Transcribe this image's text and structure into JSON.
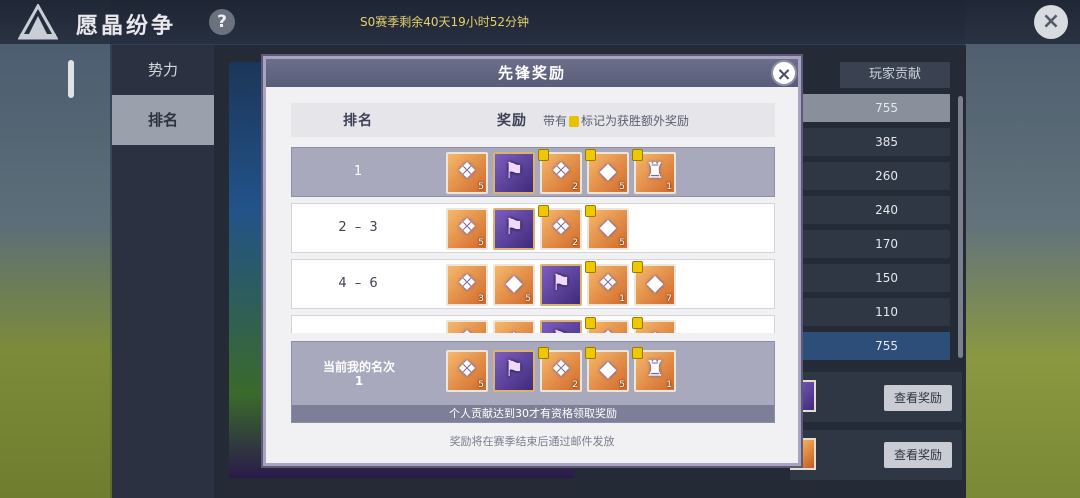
{
  "topbar": {
    "title": "愿晶纷争",
    "help_label": "?",
    "season_timer": "S0赛季剩余40天19小时52分钟",
    "close_label": "×"
  },
  "sidebar": {
    "tabs": [
      {
        "label": "势力",
        "active": false
      },
      {
        "label": "排名",
        "active": true
      }
    ]
  },
  "background": {
    "contrib_header": "玩家贡献",
    "contrib_values": [
      "755",
      "385",
      "260",
      "240",
      "170",
      "150",
      "110",
      "755"
    ],
    "view_reward_label": "查看奖励"
  },
  "modal": {
    "title": "先锋奖励",
    "close_label": "×",
    "col_rank": "排名",
    "col_reward": "奖励",
    "note_prefix": "带有",
    "note_suffix": "标记为获胜额外奖励",
    "rows": [
      {
        "rank": "1",
        "items": [
          {
            "icon": "crystal-drops",
            "qty": "5",
            "extra": false,
            "style": "orange"
          },
          {
            "icon": "purple-banner",
            "qty": "",
            "extra": false,
            "style": "purple"
          },
          {
            "icon": "crystal-drops",
            "qty": "2",
            "extra": true,
            "style": "orange"
          },
          {
            "icon": "crystal-drop",
            "qty": "5",
            "extra": true,
            "style": "orange"
          },
          {
            "icon": "trophy-chest",
            "qty": "1",
            "extra": true,
            "style": "orange"
          }
        ]
      },
      {
        "rank": "2 – 3",
        "items": [
          {
            "icon": "crystal-drops",
            "qty": "5",
            "extra": false,
            "style": "orange"
          },
          {
            "icon": "purple-banner",
            "qty": "",
            "extra": false,
            "style": "purple"
          },
          {
            "icon": "crystal-drops",
            "qty": "2",
            "extra": true,
            "style": "orange"
          },
          {
            "icon": "crystal-drop",
            "qty": "5",
            "extra": true,
            "style": "orange"
          }
        ]
      },
      {
        "rank": "4 – 6",
        "items": [
          {
            "icon": "crystal-drops",
            "qty": "3",
            "extra": false,
            "style": "orange"
          },
          {
            "icon": "crystal-drop",
            "qty": "5",
            "extra": false,
            "style": "orange"
          },
          {
            "icon": "purple-banner",
            "qty": "",
            "extra": false,
            "style": "purple"
          },
          {
            "icon": "crystal-drops",
            "qty": "1",
            "extra": true,
            "style": "orange"
          },
          {
            "icon": "crystal-drop",
            "qty": "7",
            "extra": true,
            "style": "orange"
          }
        ]
      },
      {
        "rank": "",
        "items": [
          {
            "icon": "crystal-drops",
            "qty": "",
            "extra": false,
            "style": "orange"
          },
          {
            "icon": "crystal-drop",
            "qty": "",
            "extra": false,
            "style": "orange"
          },
          {
            "icon": "purple-banner",
            "qty": "",
            "extra": false,
            "style": "purple"
          },
          {
            "icon": "crystal-drops",
            "qty": "",
            "extra": true,
            "style": "orange"
          },
          {
            "icon": "crystal-drop",
            "qty": "",
            "extra": true,
            "style": "orange"
          }
        ]
      }
    ],
    "my_rank": {
      "label": "当前我的名次",
      "value": "1",
      "items": [
        {
          "icon": "crystal-drops",
          "qty": "5",
          "extra": false,
          "style": "orange"
        },
        {
          "icon": "purple-banner",
          "qty": "",
          "extra": false,
          "style": "purple"
        },
        {
          "icon": "crystal-drops",
          "qty": "2",
          "extra": true,
          "style": "orange"
        },
        {
          "icon": "crystal-drop",
          "qty": "5",
          "extra": true,
          "style": "orange"
        },
        {
          "icon": "trophy-chest",
          "qty": "1",
          "extra": true,
          "style": "orange"
        }
      ],
      "notice": "个人贡献达到30才有资格领取奖励"
    },
    "footer": "奖励将在赛季结束后通过邮件发放"
  }
}
